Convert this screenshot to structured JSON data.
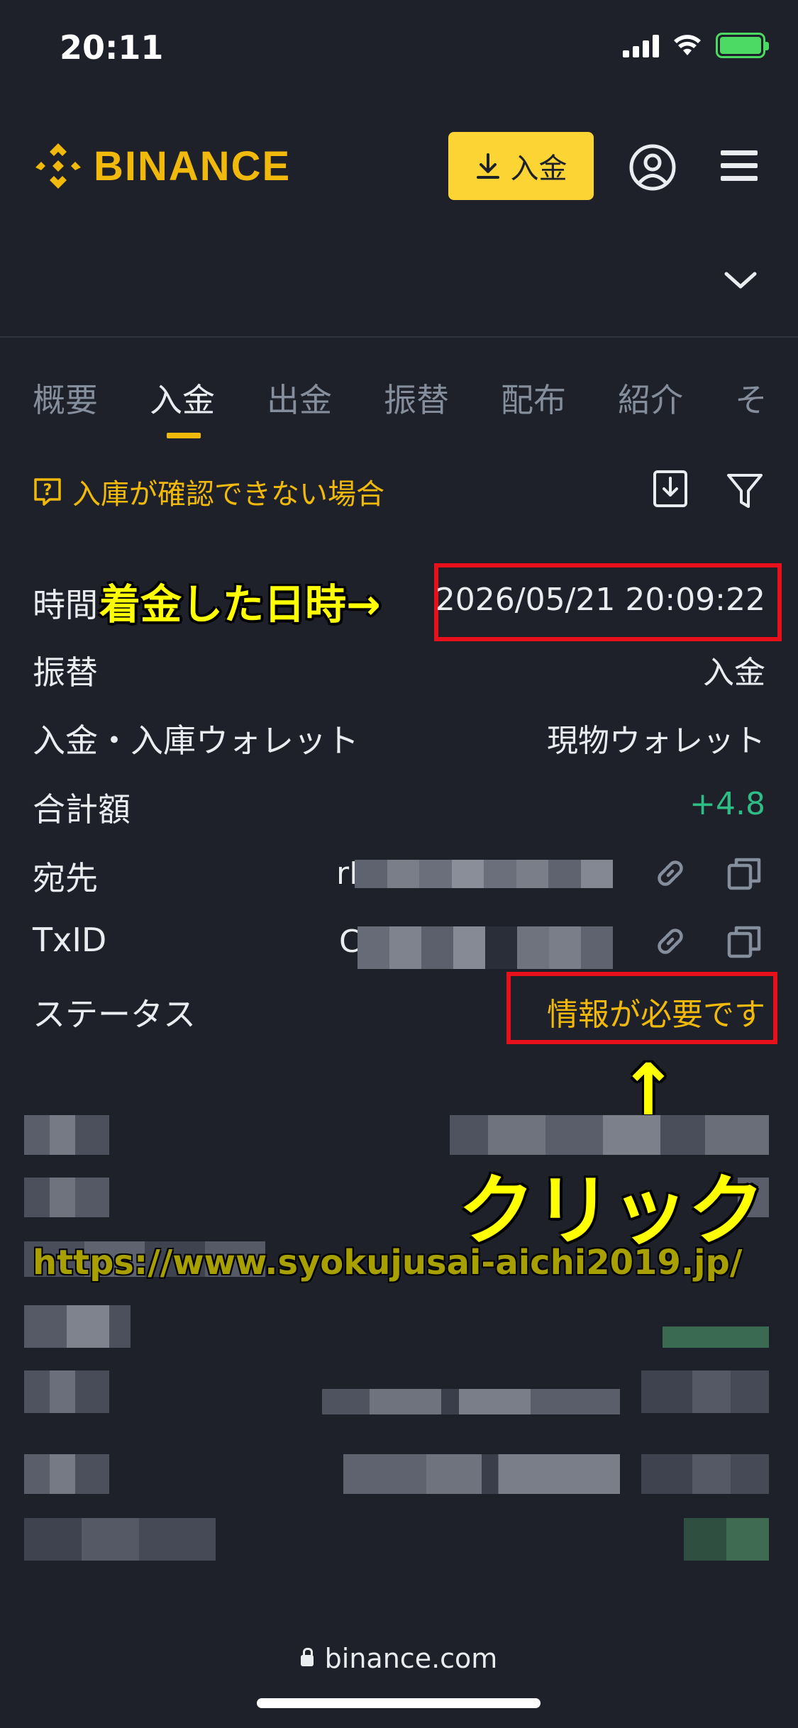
{
  "status_bar": {
    "time": "20:11"
  },
  "header": {
    "brand": "BINANCE",
    "deposit_label": "入金",
    "brand_color": "#f0b90b"
  },
  "tabs": [
    {
      "label": "概要",
      "active": false
    },
    {
      "label": "入金",
      "active": true
    },
    {
      "label": "出金",
      "active": false
    },
    {
      "label": "振替",
      "active": false
    },
    {
      "label": "配布",
      "active": false
    },
    {
      "label": "紹介",
      "active": false
    },
    {
      "label": "そ",
      "active": false
    }
  ],
  "help": {
    "text": "入庫が確認できない場合"
  },
  "details": {
    "time": {
      "label": "時間",
      "value": "2026/05/21 20:09:22"
    },
    "transfer": {
      "label": "振替",
      "value": "入金"
    },
    "wallet": {
      "label": "入金・入庫ウォレット",
      "value": "現物ウォレット"
    },
    "total": {
      "label": "合計額",
      "value": "+4.8"
    },
    "address": {
      "label": "宛先",
      "value_prefix": "rN"
    },
    "txid": {
      "label": "TxID",
      "value_prefix": "C"
    },
    "status": {
      "label": "ステータス",
      "value": "情報が必要です"
    }
  },
  "annotations": {
    "time_note": "着金した日時→",
    "click_note": "クリック",
    "arrow": "↑",
    "watermark": "https://www.syokujusai-aichi2019.jp/"
  },
  "url_bar": {
    "domain": "binance.com"
  }
}
